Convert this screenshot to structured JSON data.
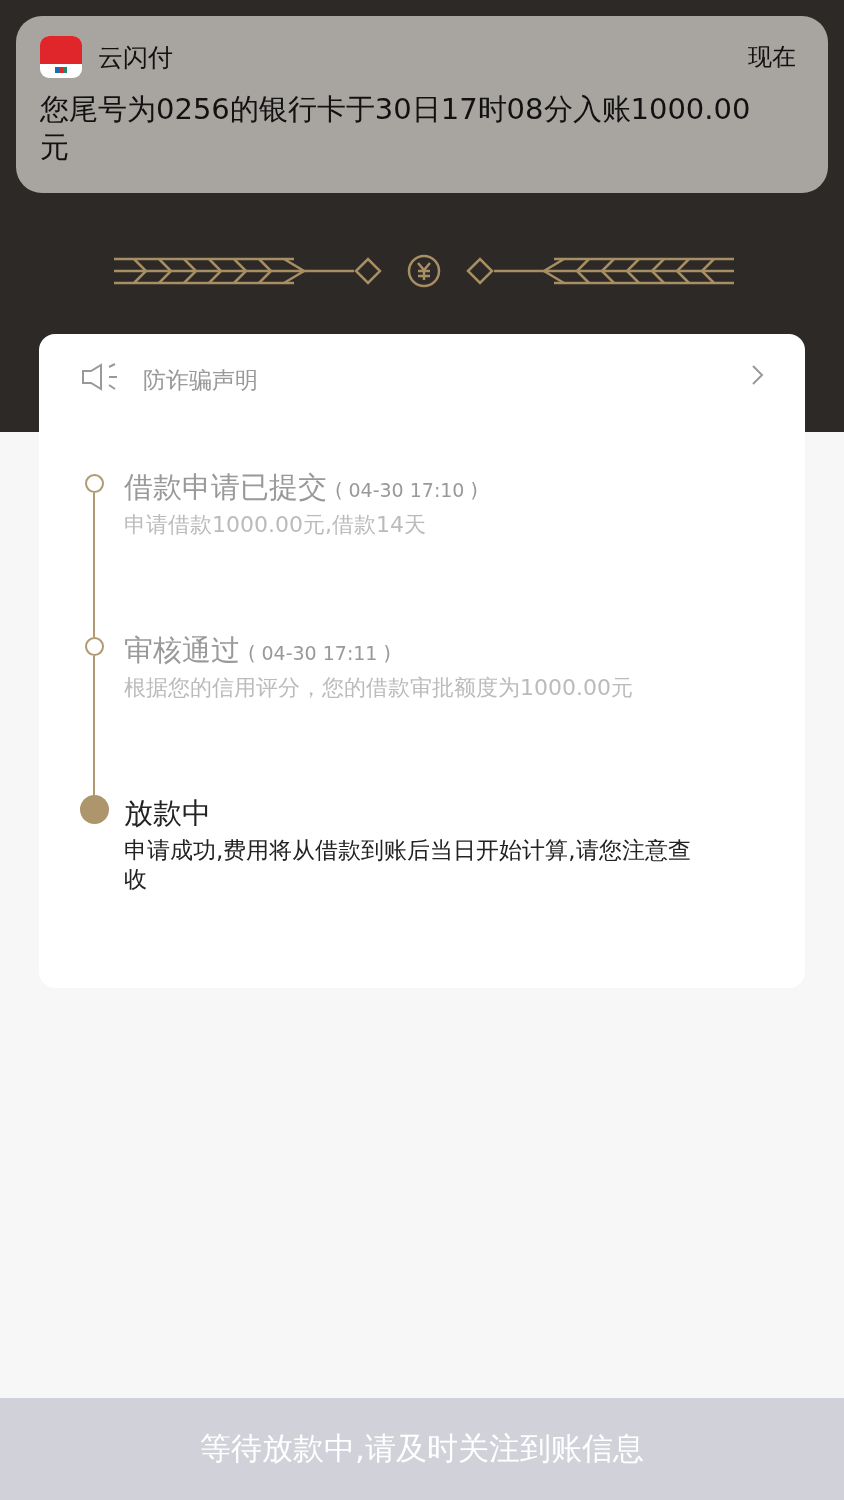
{
  "notification": {
    "app_name": "云闪付",
    "time": "现在",
    "message": "您尾号为0256的银行卡于30日17时08分入账1000.00元"
  },
  "notice_bar": {
    "label": "防诈骗声明"
  },
  "timeline": [
    {
      "title": "借款申请已提交",
      "time": "( 04-30 17:10 )",
      "description": "申请借款1000.00元,借款14天",
      "current": false
    },
    {
      "title": "审核通过",
      "time": "( 04-30 17:11 )",
      "description": "根据您的信用评分，您的借款审批额度为1000.00元",
      "current": false
    },
    {
      "title": "放款中",
      "description": "申请成功,费用将从借款到账后当日开始计算,请您注意查收",
      "current": true
    }
  ],
  "bottom_button": {
    "label": "等待放款中,请及时关注到账信息",
    "disabled": true
  }
}
